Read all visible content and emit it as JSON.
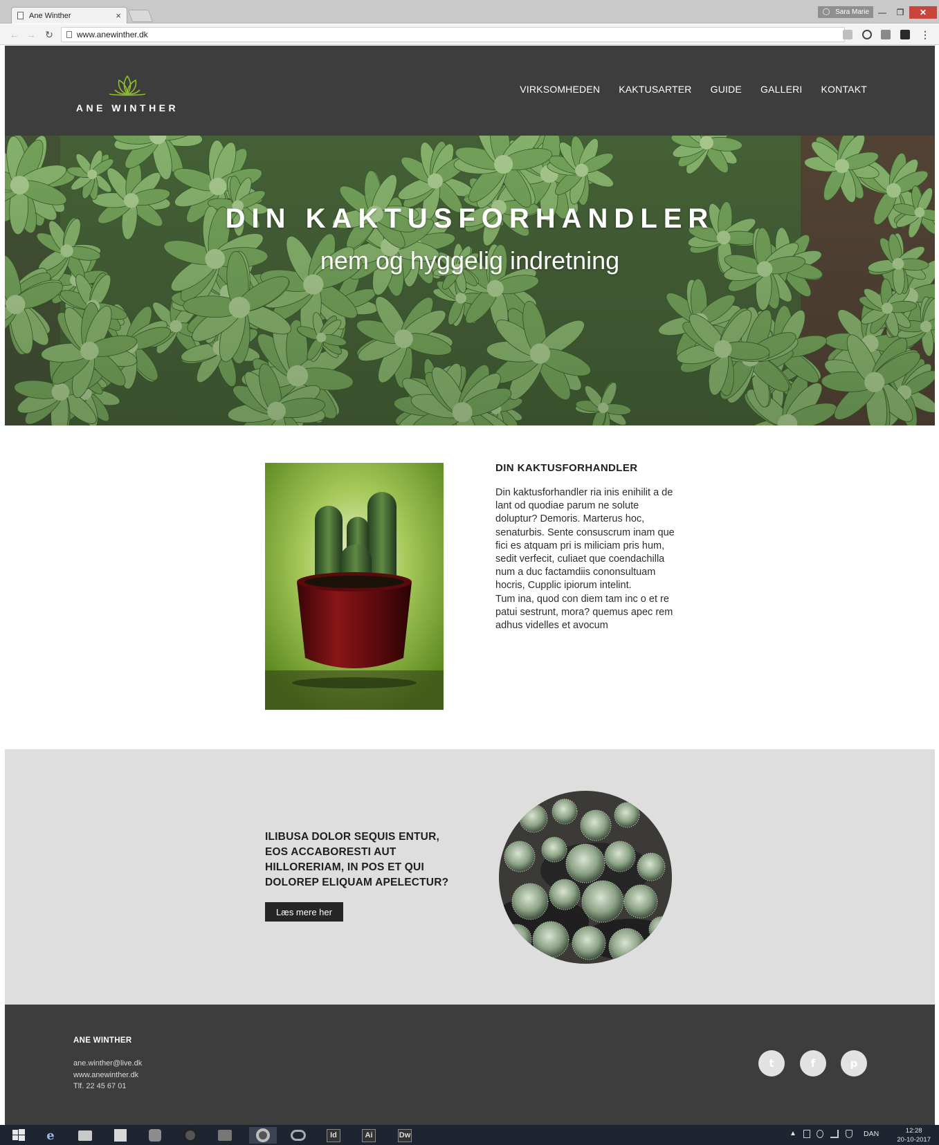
{
  "browser": {
    "tab_title": "Ane Winther",
    "tab_close": "×",
    "profile_name": "Sara Marie",
    "url": "www.anewinther.dk",
    "window_controls": {
      "minimize": "—",
      "maximize": "❐",
      "close": "✕"
    },
    "nav_icons": {
      "back": "←",
      "forward": "→",
      "reload": "↻",
      "menu": "⋮"
    }
  },
  "site": {
    "logo_text": "ANE WINTHER",
    "nav": [
      "VIRKSOMHEDEN",
      "KAKTUSARTER",
      "GUIDE",
      "GALLERI",
      "KONTAKT"
    ],
    "hero": {
      "title": "DIN KAKTUSFORHANDLER",
      "subtitle": "nem og hyggelig indretning"
    },
    "intro": {
      "heading": "DIN KAKTUSFORHANDLER",
      "paragraph_1": "Din kaktusforhandler ria inis enihilit a de lant od quodiae parum ne solute doluptur? Demoris. Marterus hoc, senaturbis. Sente consuscrum inam que fici es atquam pri is miliciam pris hum, sedit verfecit, culiaet que coendachilla num a duc factamdiis cononsultuam hocris, Cupplic ipiorum intelint.",
      "paragraph_2": "Tum ina, quod con diem tam inc o et re patui sestrunt, mora? quemus apec rem adhus videlles et avocum"
    },
    "feature": {
      "heading": "ILIBUSA DOLOR SEQUIS ENTUR, EOS ACCABORESTI AUT HILLORERIAM, IN POS ET QUI DOLOREP ELIQUAM APELECTUR?",
      "button_label": "Læs mere her"
    },
    "footer": {
      "brand": "ANE WINTHER",
      "email": "ane.winther@live.dk",
      "website": "www.anewinther.dk",
      "phone": "Tlf. 22 45 67 01",
      "social": [
        {
          "name": "twitter-icon",
          "glyph": "t"
        },
        {
          "name": "facebook-icon",
          "glyph": "f"
        },
        {
          "name": "pinterest-icon",
          "glyph": "p"
        }
      ]
    },
    "colors": {
      "header_bg": "#3d3d3d",
      "feature_bg": "#dedede",
      "logo_accent": "#8fbf2b",
      "button_bg": "#262626"
    }
  },
  "taskbar": {
    "apps": [
      "Id",
      "Ai",
      "Dw"
    ],
    "language": "DAN",
    "time": "12:28",
    "date": "20-10-2017"
  }
}
